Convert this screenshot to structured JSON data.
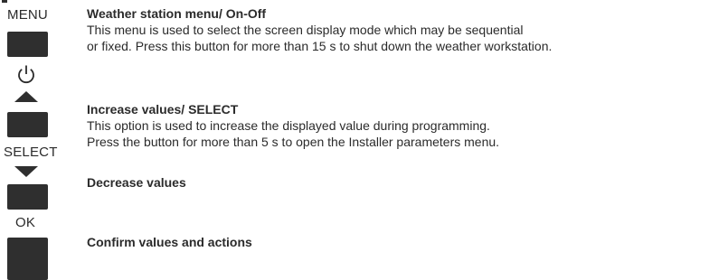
{
  "keys": {
    "menu_label": "MENU",
    "select_label": "SELECT",
    "ok_label": "OK"
  },
  "entries": {
    "menu": {
      "title": "Weather station menu/ On-Off",
      "line1": "This menu is used to select the screen display mode which may be sequential",
      "line2": "or fixed. Press this button for more than 15 s to shut down the weather workstation."
    },
    "increase": {
      "title": "Increase values/ SELECT",
      "line1": "This option is used to increase the displayed value during programming.",
      "line2": "Press the button for more than 5 s to open the Installer parameters menu."
    },
    "decrease": {
      "title": "Decrease values"
    },
    "confirm": {
      "title": "Confirm values and actions"
    }
  },
  "icons": {
    "power": "power-icon",
    "up": "up-triangle-icon",
    "down": "down-triangle-icon"
  },
  "colors": {
    "key": "#2f2f2f",
    "text": "#2b2b2b"
  }
}
